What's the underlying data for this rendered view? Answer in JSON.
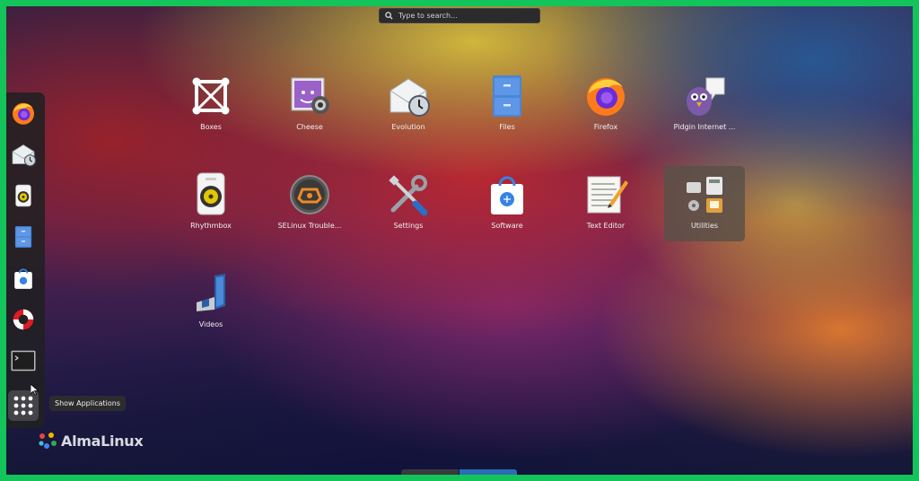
{
  "search": {
    "placeholder": "Type to search..."
  },
  "dock": {
    "items": [
      {
        "name": "Firefox",
        "icon": "firefox-icon"
      },
      {
        "name": "Evolution",
        "icon": "evolution-icon"
      },
      {
        "name": "Rhythmbox",
        "icon": "rhythmbox-icon"
      },
      {
        "name": "Files",
        "icon": "files-icon"
      },
      {
        "name": "Software",
        "icon": "software-icon"
      },
      {
        "name": "Help",
        "icon": "lifebuoy-icon"
      },
      {
        "name": "Terminal",
        "icon": "terminal-icon"
      },
      {
        "name": "Show Applications",
        "icon": "grid-icon"
      }
    ],
    "tooltip": "Show Applications"
  },
  "apps": [
    {
      "label": "Boxes",
      "icon": "boxes-icon"
    },
    {
      "label": "Cheese",
      "icon": "cheese-icon"
    },
    {
      "label": "Evolution",
      "icon": "evolution-icon"
    },
    {
      "label": "Files",
      "icon": "files-icon"
    },
    {
      "label": "Firefox",
      "icon": "firefox-icon"
    },
    {
      "label": "Pidgin Internet ...",
      "icon": "pidgin-icon"
    },
    {
      "label": "Rhythmbox",
      "icon": "rhythmbox-icon"
    },
    {
      "label": "SELinux Trouble...",
      "icon": "selinux-icon"
    },
    {
      "label": "Settings",
      "icon": "settings-icon"
    },
    {
      "label": "Software",
      "icon": "software-icon"
    },
    {
      "label": "Text Editor",
      "icon": "text-editor-icon"
    },
    {
      "label": "Utilities",
      "icon": "utilities-folder-icon"
    },
    {
      "label": "Videos",
      "icon": "videos-icon"
    }
  ],
  "brand": {
    "text": "AlmaLinux",
    "icon": "almalinux-logo"
  },
  "colors": {
    "frame": "#12c45a",
    "accent": "#2a6db5",
    "dock": "#202022"
  }
}
